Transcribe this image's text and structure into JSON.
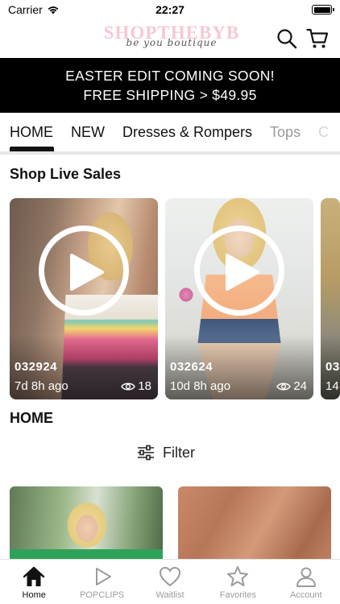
{
  "status_bar": {
    "carrier": "Carrier",
    "time": "22:27"
  },
  "header": {
    "logo_main": "SHOPTHEBYB",
    "logo_sub": "be you boutique",
    "icons": [
      "search-icon",
      "cart-icon"
    ]
  },
  "banner": {
    "line1": "EASTER EDIT COMING SOON!",
    "line2": "FREE SHIPPING > $49.95"
  },
  "tabs": [
    {
      "label": "HOME",
      "active": true
    },
    {
      "label": "NEW"
    },
    {
      "label": "Dresses & Rompers"
    },
    {
      "label": "Tops"
    },
    {
      "label": "C"
    }
  ],
  "live_sales": {
    "title": "Shop Live Sales",
    "cards": [
      {
        "code": "032924",
        "ago": "7d 8h ago",
        "views": "18"
      },
      {
        "code": "032624",
        "ago": "10d 8h ago",
        "views": "24"
      },
      {
        "code": "03",
        "ago": "14",
        "views": ""
      }
    ]
  },
  "home_section": {
    "title": "HOME",
    "filter_label": "Filter"
  },
  "tab_bar": {
    "items": [
      {
        "label": "Home",
        "icon": "home-icon",
        "active": true
      },
      {
        "label": "POPCLIPS",
        "icon": "play-icon"
      },
      {
        "label": "Waitlist",
        "icon": "heart-icon"
      },
      {
        "label": "Favorites",
        "icon": "star-icon"
      },
      {
        "label": "Account",
        "icon": "person-icon"
      }
    ]
  },
  "colors": {
    "banner_bg": "#000000",
    "logo_pink": "#f6c9d2",
    "inactive_tab": "#9b9b9b"
  }
}
